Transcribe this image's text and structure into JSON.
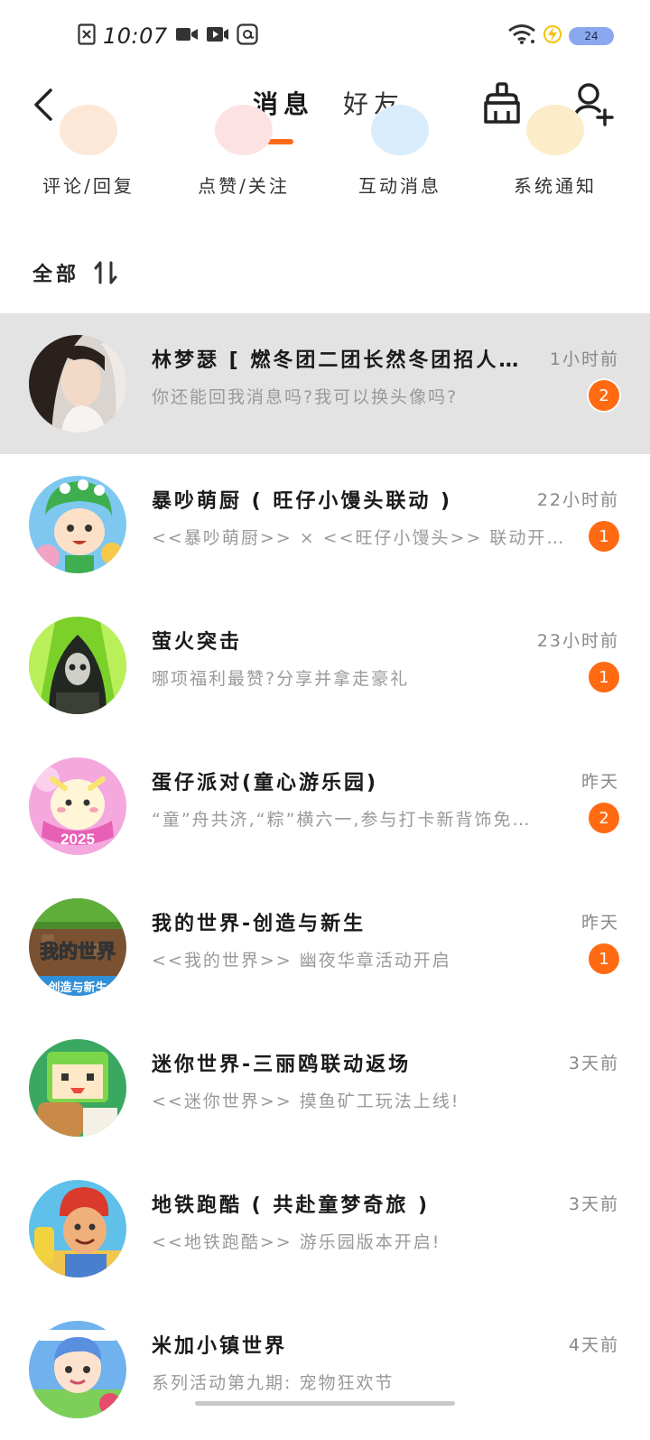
{
  "status_bar": {
    "time": "10:07",
    "battery_level": "24",
    "icons": [
      "close-box-icon",
      "video-camera-icon",
      "video-play-icon",
      "at-sign-icon",
      "wifi-icon",
      "charging-icon",
      "battery-icon"
    ]
  },
  "nav": {
    "tabs": [
      {
        "label": "消息",
        "active": true
      },
      {
        "label": "好友",
        "active": false
      }
    ],
    "icons": [
      "back-arrow-icon",
      "broom-icon",
      "add-user-icon"
    ]
  },
  "categories": [
    {
      "label": "评论/回复",
      "color": "#fde7d6"
    },
    {
      "label": "点赞/关注",
      "color": "#fde2e4"
    },
    {
      "label": "互动消息",
      "color": "#d9ecfb"
    },
    {
      "label": "系统通知",
      "color": "#fdecc9"
    }
  ],
  "section": {
    "title": "全部",
    "sort_icon": "sort-icon"
  },
  "messages": [
    {
      "name": "林梦瑟 [ 燃冬团二团长然冬团招人…",
      "time": "1小时前",
      "preview": "你还能回我消息吗?我可以换头像吗?",
      "badge": "2"
    },
    {
      "name": "暴吵萌厨 ( 旺仔小馒头联动 )",
      "time": "22小时前",
      "preview": "<<暴吵萌厨>> × <<旺仔小馒头>> 联动开启!",
      "badge": "1"
    },
    {
      "name": "萤火突击",
      "time": "23小时前",
      "preview": "哪项福利最赞?分享并拿走豪礼",
      "badge": "1"
    },
    {
      "name": "蛋仔派对(童心游乐园)",
      "time": "昨天",
      "preview": "“童”舟共济,“粽”横六一,参与打卡新背饰免…",
      "badge": "2"
    },
    {
      "name": "我的世界-创造与新生",
      "time": "昨天",
      "preview": "<<我的世界>> 幽夜华章活动开启",
      "badge": "1"
    },
    {
      "name": "迷你世界-三丽鸥联动返场",
      "time": "3天前",
      "preview": "<<迷你世界>> 摸鱼矿工玩法上线!",
      "badge": ""
    },
    {
      "name": "地铁跑酷 ( 共赴童梦奇旅 )",
      "time": "3天前",
      "preview": "<<地铁跑酷>> 游乐园版本开启!",
      "badge": ""
    },
    {
      "name": "米加小镇世界",
      "time": "4天前",
      "preview": "系列活动第九期: 宠物狂欢节",
      "badge": ""
    }
  ],
  "avatar_texts": {
    "minecraft_logo": "我的世界",
    "minecraft_sub": "创造与新生",
    "eggy_year": "2025"
  },
  "accent_color": "#ff6a12"
}
